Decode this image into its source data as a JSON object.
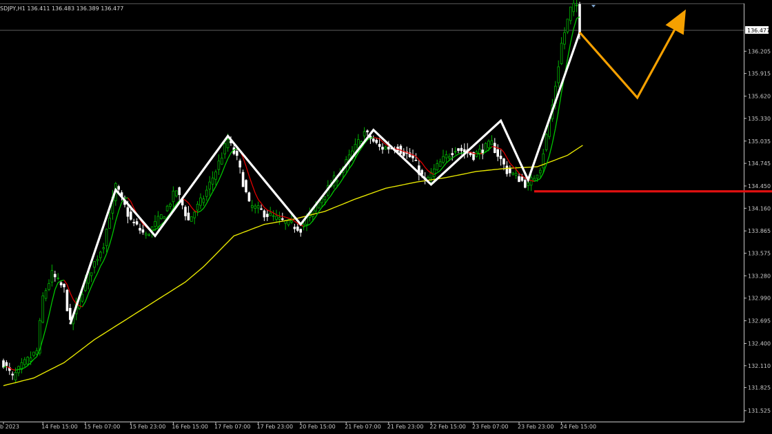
{
  "chart_data": {
    "type": "candlestick",
    "info_line": "SDJPY,H1  136.411 136.483 136.389 136.477",
    "current_price_label": "136.477",
    "ylim": [
      131.4,
      136.8
    ],
    "y_ticks": [
      "136.205",
      "135.915",
      "135.620",
      "135.330",
      "135.035",
      "134.745",
      "134.450",
      "134.160",
      "133.865",
      "133.575",
      "133.280",
      "132.990",
      "132.695",
      "132.400",
      "132.110",
      "131.825",
      "131.525"
    ],
    "x_ticks": [
      "b 2023",
      "14 Feb 15:00",
      "15 Feb 07:00",
      "15 Feb 23:00",
      "16 Feb 15:00",
      "17 Feb 07:00",
      "17 Feb 23:00",
      "20 Feb 15:00",
      "21 Feb 07:00",
      "21 Feb 23:00",
      "22 Feb 15:00",
      "23 Feb 07:00",
      "23 Feb 23:00",
      "24 Feb 15:00"
    ],
    "x_tick_index": [
      0,
      13,
      27,
      42,
      56,
      70,
      84,
      98,
      113,
      127,
      141,
      155,
      170,
      184
    ],
    "visible_bars": 195,
    "ohlc_anchors": [
      [
        0,
        132.15
      ],
      [
        3,
        131.95
      ],
      [
        6,
        132.1
      ],
      [
        11,
        132.3
      ],
      [
        13,
        133.0
      ],
      [
        16,
        133.3
      ],
      [
        20,
        133.1
      ],
      [
        22,
        132.65
      ],
      [
        27,
        133.2
      ],
      [
        33,
        133.7
      ],
      [
        37,
        134.45
      ],
      [
        42,
        134.0
      ],
      [
        47,
        133.8
      ],
      [
        53,
        134.1
      ],
      [
        57,
        134.4
      ],
      [
        61,
        134.0
      ],
      [
        66,
        134.3
      ],
      [
        70,
        134.65
      ],
      [
        74,
        135.05
      ],
      [
        77,
        134.8
      ],
      [
        81,
        134.2
      ],
      [
        86,
        134.1
      ],
      [
        91,
        134.0
      ],
      [
        98,
        133.9
      ],
      [
        105,
        134.3
      ],
      [
        113,
        134.75
      ],
      [
        119,
        135.15
      ],
      [
        124,
        134.95
      ],
      [
        130,
        134.95
      ],
      [
        135,
        134.8
      ],
      [
        139,
        134.5
      ],
      [
        144,
        134.75
      ],
      [
        149,
        134.95
      ],
      [
        155,
        134.85
      ],
      [
        161,
        135.0
      ],
      [
        166,
        134.65
      ],
      [
        170,
        134.55
      ],
      [
        173,
        134.45
      ],
      [
        177,
        134.7
      ],
      [
        181,
        135.5
      ],
      [
        184,
        136.3
      ],
      [
        187,
        136.75
      ],
      [
        189,
        136.8
      ],
      [
        190,
        136.477
      ]
    ],
    "sma_anchors": [
      [
        0,
        131.85
      ],
      [
        10,
        131.95
      ],
      [
        20,
        132.15
      ],
      [
        30,
        132.45
      ],
      [
        40,
        132.7
      ],
      [
        50,
        132.95
      ],
      [
        60,
        133.2
      ],
      [
        66,
        133.4
      ],
      [
        76,
        133.8
      ],
      [
        86,
        133.95
      ],
      [
        96,
        134.02
      ],
      [
        106,
        134.12
      ],
      [
        116,
        134.28
      ],
      [
        126,
        134.42
      ],
      [
        136,
        134.5
      ],
      [
        146,
        134.56
      ],
      [
        156,
        134.64
      ],
      [
        166,
        134.68
      ],
      [
        176,
        134.7
      ],
      [
        186,
        134.85
      ],
      [
        191,
        134.98
      ]
    ],
    "zigzag": [
      [
        22,
        132.65
      ],
      [
        37,
        134.4
      ],
      [
        50,
        133.8
      ],
      [
        74,
        135.1
      ],
      [
        98,
        133.95
      ],
      [
        122,
        135.18
      ],
      [
        141,
        134.47
      ],
      [
        164,
        135.3
      ],
      [
        173,
        134.53
      ],
      [
        190,
        136.45
      ]
    ],
    "projection": [
      [
        190,
        136.45
      ],
      [
        209,
        135.6
      ],
      [
        225,
        136.75
      ]
    ],
    "support_level": 134.38,
    "support_start_index": 175,
    "colors": {
      "background": "#000000",
      "bull_candle": "#00b400",
      "bear_candle": "#ffffff",
      "ma_fast_up": "#00c800",
      "ma_fast_down": "#e00000",
      "ma_slow": "#e6e600",
      "zigzag": "#ffffff",
      "projection": "#f5a000",
      "support": "#e01010",
      "price_line": "#808080",
      "axis_text": "#c8c8c8"
    }
  }
}
